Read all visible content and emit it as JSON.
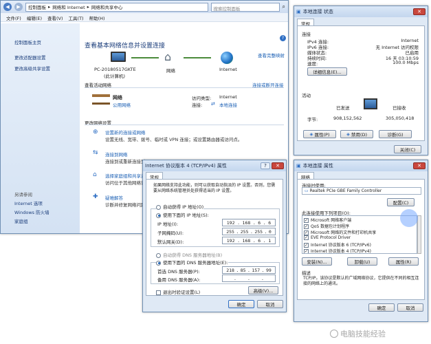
{
  "explorer": {
    "breadcrumb": [
      "控制面板",
      "网络和 Internet",
      "网络和共享中心"
    ],
    "search_placeholder": "搜索控制面板",
    "menu": [
      "文件(F)",
      "编辑(E)",
      "查看(V)",
      "工具(T)",
      "帮助(H)"
    ],
    "sidebar": {
      "top": [
        "控制面板主页",
        "更改适配器设置",
        "更改高级共享设置"
      ],
      "see_also_title": "另请参阅",
      "see_also": [
        "Internet 选项",
        "Windows 防火墙",
        "家庭组"
      ]
    },
    "heading": "查看基本网络信息并设置连接",
    "full_map": "查看完整映射",
    "map": {
      "pc": "PC-20180517GKTE",
      "pc_sub": "(此计算机)",
      "net": "网络",
      "internet": "Internet"
    },
    "active_title": "查看活动网络",
    "connect_link": "连接或断开连接",
    "network_name": "网络",
    "network_type": "公用网络",
    "access_type_label": "访问类型:",
    "access_type": "Internet",
    "connection_label": "连接:",
    "connection": "本地连接",
    "change_title": "更改网络设置",
    "tasks": [
      {
        "title": "设置新的连接或网络",
        "desc": "设置无线、宽带、拨号、临时或 VPN 连接；或设置路由器或访问点。"
      },
      {
        "title": "连接到网络",
        "desc": "连接到或重新连接到无线、有线、拨号或 VPN 网络连接。"
      },
      {
        "title": "选择家庭组和共享选项",
        "desc": "访问位于其他网络计算机上的文件和打印机，或更改共享设置。"
      },
      {
        "title": "疑难解答",
        "desc": "诊断并修复网络问题，或获得故障排除信息。"
      }
    ]
  },
  "status": {
    "title": "本地连接 状态",
    "tab": "常规",
    "connection_title": "连接",
    "rows": [
      [
        "IPv4 连接:",
        "Internet"
      ],
      [
        "IPv6 连接:",
        "无 Internet 访问权限"
      ],
      [
        "媒体状态:",
        "已启用"
      ],
      [
        "持续时间:",
        "16 天 03:10:59"
      ],
      [
        "速度:",
        "100.0 Mbps"
      ]
    ],
    "details_btn": "详细信息(E)...",
    "activity_title": "活动",
    "sent": "已发送",
    "received": "已接收",
    "bytes_label": "字节:",
    "bytes_sent": "908,152,562",
    "bytes_recv": "305,050,418",
    "btns": [
      "属性(P)",
      "禁用(D)",
      "诊断(G)"
    ],
    "close": "关闭(C)"
  },
  "props": {
    "title": "本地连接 属性",
    "tab": "网络",
    "connect_using": "连接时使用:",
    "adapter": "Realtek PCIe GBE Family Controller",
    "config_btn": "配置(C)",
    "items_title": "此连接使用下列项目(O):",
    "items": [
      "Microsoft 网络客户端",
      "QoS 数据包计划程序",
      "Microsoft 网络的文件和打印机共享",
      "EVE Protocol Driver",
      "Internet 协议版本 6 (TCP/IPv6)",
      "Internet 协议版本 4 (TCP/IPv4)"
    ],
    "btns": [
      "安装(N)...",
      "卸载(U)",
      "属性(R)"
    ],
    "desc_title": "描述",
    "desc": "TCP/IP。该协议是默认的广域网络协议，它提供在不同的相互连接的网络上的通讯。",
    "ok": "确定",
    "cancel": "取消"
  },
  "ipv4": {
    "title": "Internet 协议版本 4 (TCP/IPv4) 属性",
    "tab": "常规",
    "intro": "如果网络支持此功能，则可以获取自动指派的 IP 设置。否则，您需要从网络系统管理员处获得适当的 IP 设置。",
    "auto_ip": "自动获得 IP 地址(O)",
    "manual_ip": "使用下面的 IP 地址(S):",
    "ip_label": "IP 地址(I):",
    "ip": [
      "192",
      "168",
      "6",
      "6"
    ],
    "mask_label": "子网掩码(U):",
    "mask": [
      "255",
      "255",
      "255",
      "0"
    ],
    "gw_label": "默认网关(D):",
    "gw": [
      "192",
      "168",
      "6",
      "1"
    ],
    "auto_dns": "自动获得 DNS 服务器地址(B)",
    "manual_dns": "使用下面的 DNS 服务器地址(E):",
    "dns1_label": "首选 DNS 服务器(P):",
    "dns1": [
      "218",
      "85",
      "157",
      "99"
    ],
    "dns2_label": "备用 DNS 服务器(A):",
    "dns2": [
      "",
      "",
      "",
      ""
    ],
    "validate": "退出时验证设置(L)",
    "advanced": "高级(V)...",
    "ok": "确定",
    "cancel": "取消"
  },
  "watermark": "电脑技能经验"
}
